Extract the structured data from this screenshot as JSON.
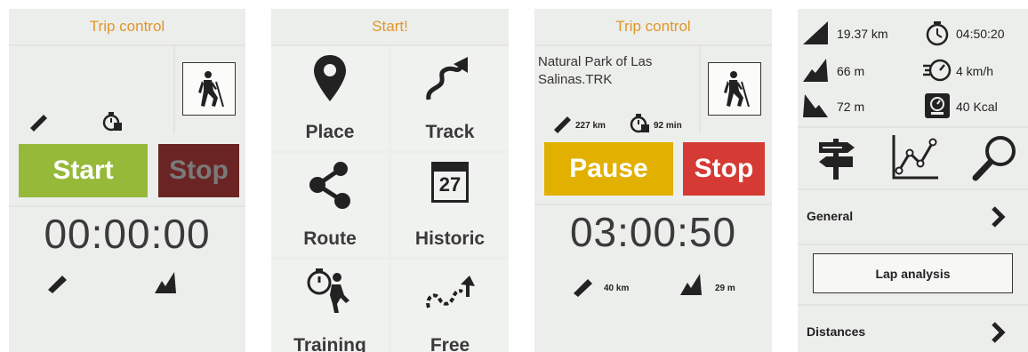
{
  "trip_idle": {
    "header": "Trip control",
    "start_label": "Start",
    "stop_label": "Stop",
    "timer": "00:00:00"
  },
  "start_menu": {
    "header": "Start!",
    "items": [
      "Place",
      "Track",
      "Route",
      "Historic",
      "Training",
      "Free"
    ],
    "calendar_day": "27"
  },
  "trip_active": {
    "header": "Trip control",
    "track_name": "Natural Park of Las Salinas.TRK",
    "track_distance": "227 km",
    "track_time": "92 min",
    "pause_label": "Pause",
    "stop_label": "Stop",
    "timer": "03:00:50",
    "distance": "40 km",
    "altitude": "29 m"
  },
  "stats": {
    "distance": "19.37 km",
    "time": "04:50:20",
    "ascent": "66 m",
    "speed": "4 km/h",
    "descent": "72 m",
    "calories": "40 Kcal",
    "general_label": "General",
    "lap_button": "Lap analysis",
    "distances_label": "Distances"
  },
  "colors": {
    "accent": "#e0962a",
    "start_green": "#96b93a",
    "stop_dark": "#6b2424",
    "pause_yellow": "#e2b000",
    "stop_red": "#d53a34"
  }
}
